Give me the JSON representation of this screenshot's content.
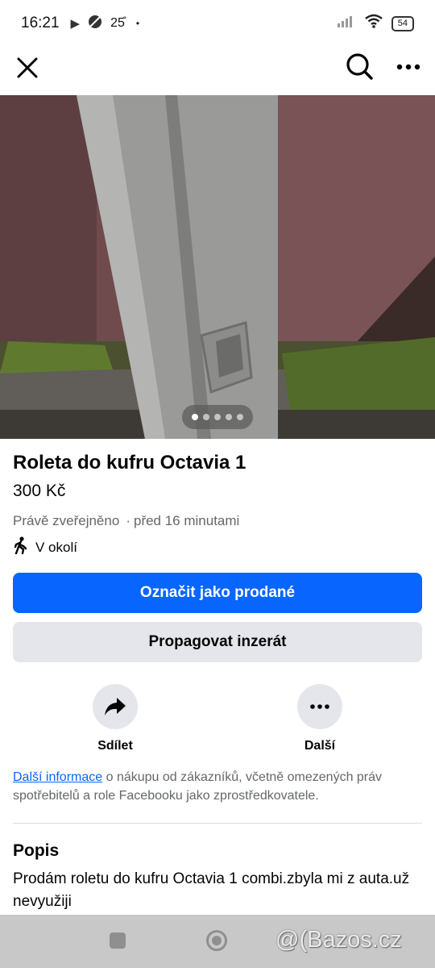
{
  "status_bar": {
    "time": "16:21",
    "temperature": "25̊",
    "dot": "•",
    "battery": "54",
    "icons": [
      "play-icon",
      "app-icon",
      "signal-icon",
      "wifi-icon",
      "battery-icon"
    ]
  },
  "toolbar": {
    "icons": [
      "close-icon",
      "search-icon",
      "more-icon"
    ]
  },
  "photo": {
    "image_count": 5,
    "active_index": 0
  },
  "listing": {
    "title": "Roleta do kufru Octavia 1",
    "price": "300 Kč",
    "posted": "Právě zveřejněno",
    "separator": "·",
    "posted_ago": "před 16 minutami",
    "location": "V okolí"
  },
  "buttons": {
    "mark_sold": "Označit jako prodané",
    "promote": "Propagovat inzerát"
  },
  "actions": {
    "share": "Sdílet",
    "more": "Další"
  },
  "info": {
    "link": "Další informace",
    "text": " o nákupu od zákazníků, včetně omezených práv spotřebitelů a role Facebooku jako zprostředkovatele."
  },
  "description": {
    "heading": "Popis",
    "text": "Prodám roletu do kufru Octavia 1 combi.zbyla mi z auta.už nevyužiji"
  },
  "watermark": "@(Bazos.cz",
  "colors": {
    "primary": "#0866ff",
    "secondary_bg": "#e4e6eb",
    "text_secondary": "#65676b"
  }
}
